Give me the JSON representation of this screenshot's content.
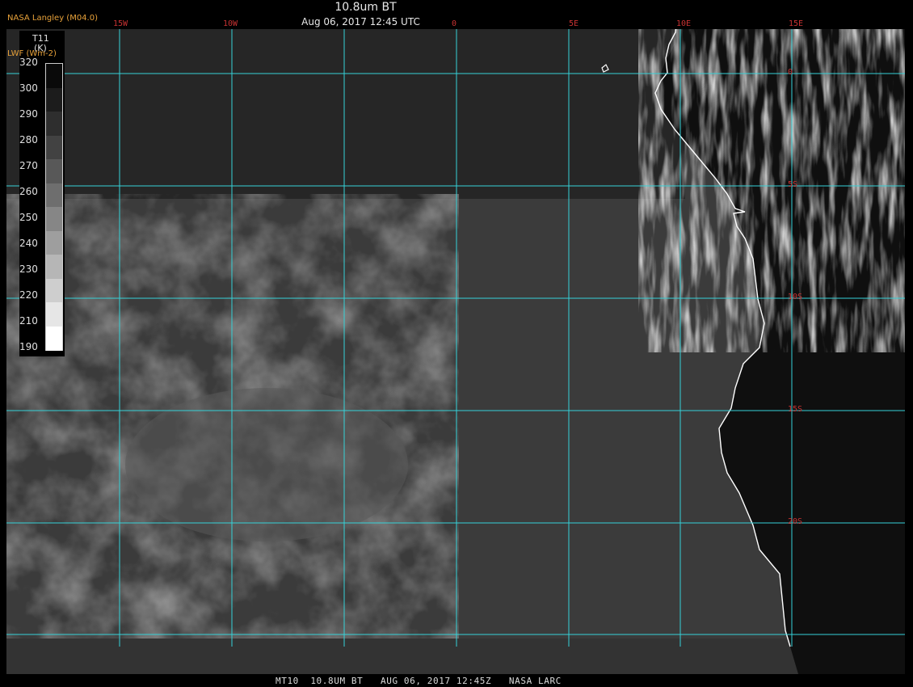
{
  "header": {
    "credit": "NASA Langley (M04.0)",
    "title": "10.8um BT",
    "subtitle": "Aug 06, 2017 12:45 UTC"
  },
  "footer": "MT10  10.8UM BT   AUG 06, 2017 12:45Z   NASA LARC",
  "legend": {
    "variable": "T11",
    "unit": "(K)",
    "product": "LWF (Wm-2)",
    "ticks": [
      "320",
      "300",
      "290",
      "280",
      "270",
      "260",
      "250",
      "240",
      "230",
      "220",
      "210",
      "190"
    ],
    "ramp_colors": [
      "#0a0a0a",
      "#1c1c1c",
      "#2e2e2e",
      "#424242",
      "#585858",
      "#6e6e6e",
      "#868686",
      "#9e9e9e",
      "#b6b6b6",
      "#cecece",
      "#e6e6e6",
      "#ffffff"
    ]
  },
  "grid": {
    "longitude_labels": [
      "15W",
      "10W",
      "0",
      "5E",
      "10E",
      "15E"
    ],
    "latitude_labels": [
      "0",
      "5S",
      "10S",
      "15S",
      "20S"
    ],
    "line_color": "#35d2d8",
    "label_color": "#c83232"
  },
  "map": {
    "coastline_color": "#ffffff",
    "ocean_gray": "#3c3c3c",
    "land_gray": "#101010"
  }
}
